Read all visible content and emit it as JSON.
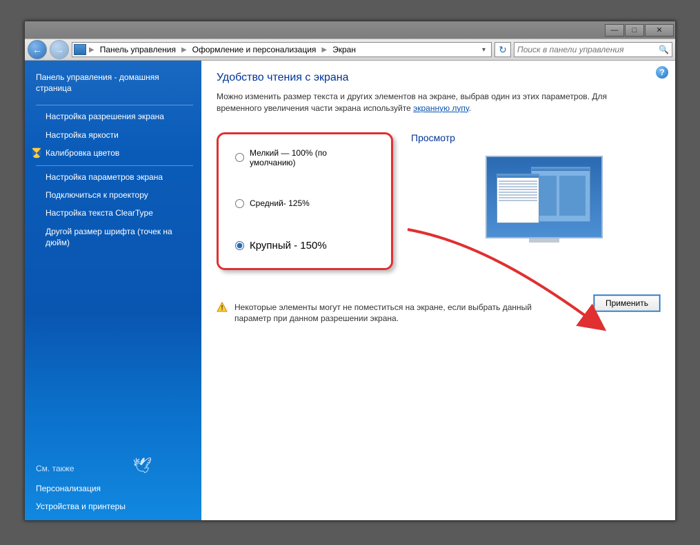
{
  "titlebar": {
    "minimize": "—",
    "maximize": "□",
    "close": "✕"
  },
  "toolbar": {
    "back": "←",
    "forward": "→",
    "refresh": "↻"
  },
  "breadcrumb": {
    "root": "Панель управления",
    "level1": "Оформление и персонализация",
    "level2": "Экран"
  },
  "search": {
    "placeholder": "Поиск в панели управления",
    "icon": "🔍"
  },
  "sidebar": {
    "home": "Панель управления - домашняя страница",
    "links": [
      "Настройка разрешения экрана",
      "Настройка яркости",
      "Калибровка цветов",
      "Настройка параметров экрана",
      "Подключиться к проектору",
      "Настройка текста ClearType",
      "Другой размер шрифта (точек на дюйм)"
    ],
    "see_also_header": "См. также",
    "see_also": [
      "Персонализация",
      "Устройства и принтеры"
    ]
  },
  "content": {
    "help": "?",
    "title": "Удобство чтения с экрана",
    "desc_pre": "Можно изменить размер текста и других элементов на экране, выбрав один из этих параметров. Для временного увеличения части экрана используйте ",
    "desc_link": "экранную лупу",
    "desc_post": ".",
    "options": {
      "small": "Мелкий — 100% (по умолчанию)",
      "medium": "Средний- 125%",
      "large": "Крупный - 150%",
      "selected": "large"
    },
    "preview_header": "Просмотр",
    "warning": "Некоторые элементы могут не поместиться на экране, если выбрать данный параметр при данном разрешении экрана.",
    "apply": "Применить"
  }
}
